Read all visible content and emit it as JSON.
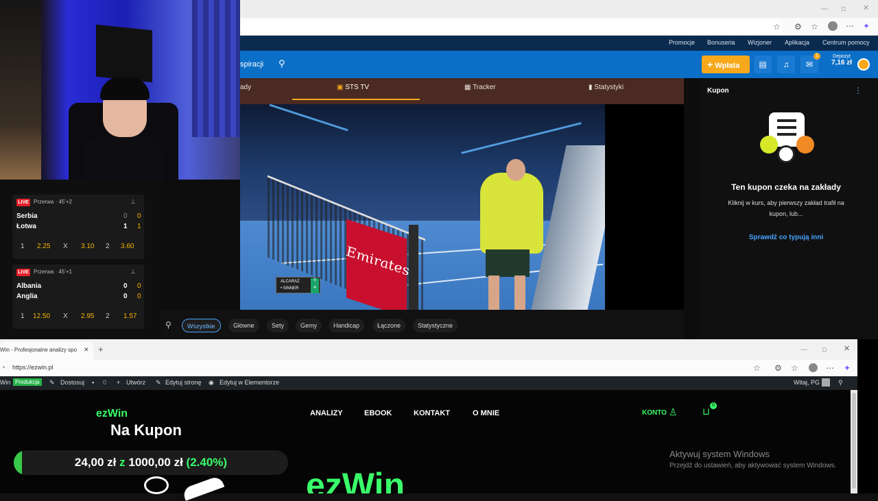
{
  "sts": {
    "nav_links": [
      "Promocje",
      "Bonuseria",
      "Wizjoner",
      "Aplikacja",
      "Centrum pomocy"
    ],
    "search_partial": "spiracji",
    "wplata_label": "Wpłata",
    "notification_count": "1",
    "depozyt_label": "Depozyt",
    "depozyt_value": "7,16 zł",
    "tabs": {
      "partial": "ady",
      "stv": "STS TV",
      "tracker": "Tracker",
      "stats": "Statystyki"
    },
    "scorebug": {
      "p1": "ALCARAZ",
      "p2": "• SINNER",
      "s1": "5",
      "s2": "4"
    },
    "emirates": "Emirates",
    "markets": [
      "Wszystkie",
      "Główne",
      "Sety",
      "Gemy",
      "Handicap",
      "Łączone",
      "Statystyczne"
    ],
    "matches": [
      {
        "status": "LIVE",
        "period": "Przerwa · 45'+2",
        "home": "Serbia",
        "away": "Łotwa",
        "home_score": "0",
        "home_score2": "0",
        "away_score": "1",
        "away_score2": "1",
        "o1_label": "1",
        "o1": "2.25",
        "ox_label": "X",
        "ox": "3.10",
        "o2_label": "2",
        "o2": "3.60"
      },
      {
        "status": "LIVE",
        "period": "Przerwa · 45'+1",
        "home": "Albania",
        "away": "Anglia",
        "home_score": "0",
        "home_score2": "0",
        "away_score": "0",
        "away_score2": "0",
        "o1_label": "1",
        "o1": "12.50",
        "ox_label": "X",
        "ox": "2.95",
        "o2_label": "2",
        "o2": "1.57"
      }
    ],
    "kupon": {
      "title": "Kupon",
      "heading": "Ten kupon czeka na zakłady",
      "line1": "Kliknij w kurs, aby pierwszy zakład trafił na",
      "line2": "kupon, lub...",
      "link": "Sprawdź co typują inni"
    }
  },
  "ez": {
    "tab_title": "Win - Profesjonalne analizy spo",
    "url": "https://ezwin.pl",
    "wp_bar": {
      "site": "Win",
      "env": "Produkcja",
      "customize": "Dostosuj",
      "comments": "0",
      "create": "Utwórz",
      "edit_page": "Edytuj stronę",
      "elementor": "Edytuj w Elementorze",
      "greeting": "Witaj, PG"
    },
    "logo": "ezWin",
    "nav": [
      "ANALIZY",
      "EBOOK",
      "KONTAKT",
      "O MNIE"
    ],
    "konto": "KONTO",
    "cart_count": "0",
    "overlay_title": "Na Kupon",
    "progress_text_a": "24,00 zł",
    "progress_text_z1": "z",
    "progress_text_b": "1000,00 zł",
    "progress_text_pct": "(2.40%)",
    "progress_value": 0.024,
    "hero_partial": "ezWin",
    "windows_title": "Aktywuj system Windows",
    "windows_sub": "Przejdź do ustawień, aby aktywować system Windows."
  },
  "colors": {
    "accent_green": "#39ff6a",
    "sts_blue": "#0b6fc7",
    "sts_orange": "#f7a81b",
    "odds_yellow": "#f5b400"
  }
}
